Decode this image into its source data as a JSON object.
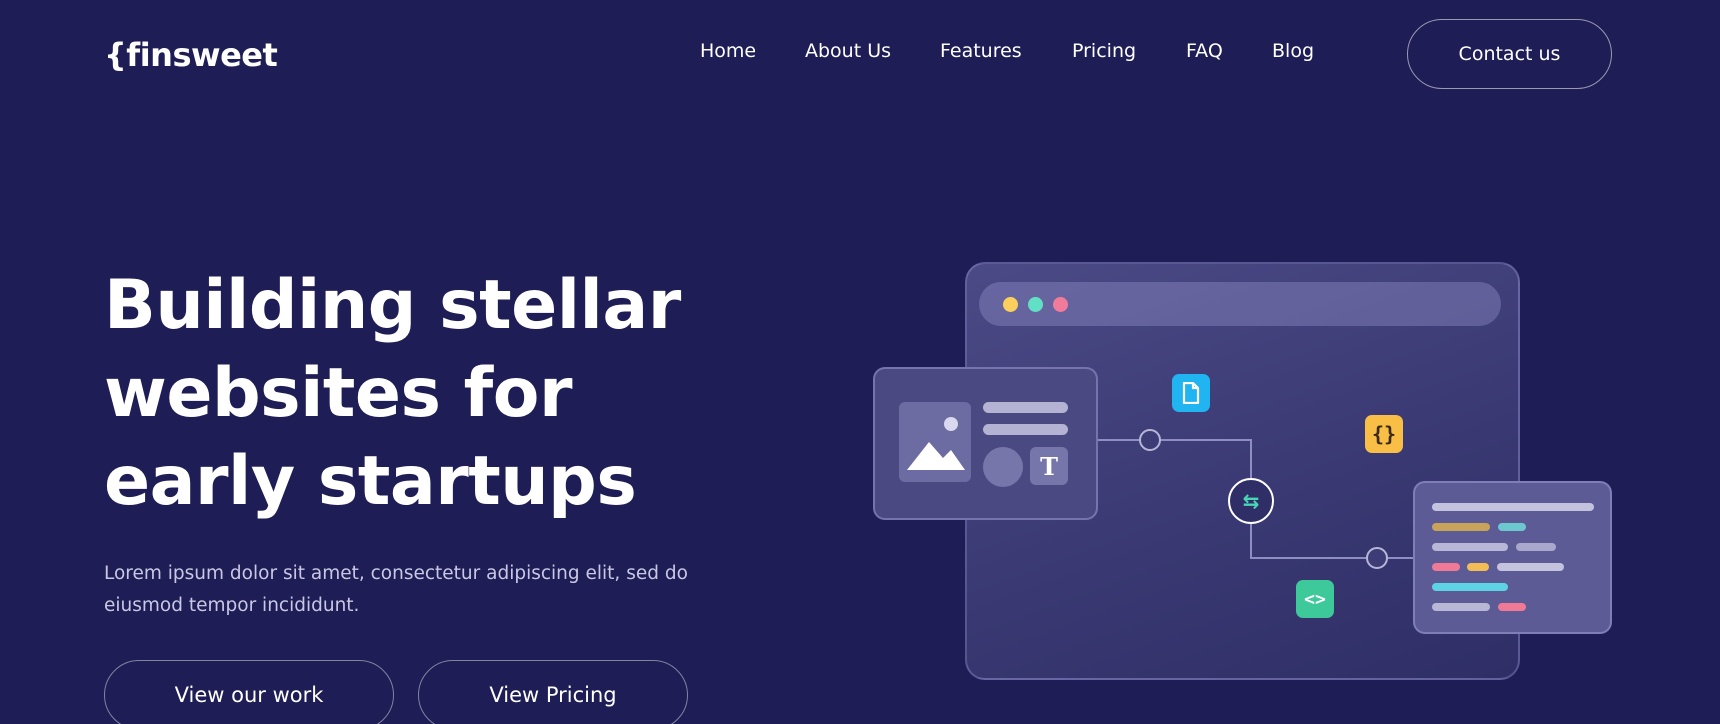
{
  "brand": {
    "logo": "{finsweet"
  },
  "nav": {
    "items": [
      "Home",
      "About Us",
      "Features",
      "Pricing",
      "FAQ",
      "Blog"
    ],
    "contact_label": "Contact us"
  },
  "hero": {
    "title": "Building stellar websites for early startups",
    "subtitle": "Lorem ipsum dolor sit amet, consectetur adipiscing elit, sed do eiusmod tempor incididunt.",
    "primary_cta": "View our work",
    "secondary_cta": "View Pricing"
  },
  "illustration": {
    "json_badge": "{}",
    "code_badge": "<>",
    "text_tile": "T",
    "colors": {
      "background": "#1e1d55",
      "dot_yellow": "#fbcf5b",
      "dot_teal": "#62e0c5",
      "dot_pink": "#f27a9a",
      "file_badge": "#20b4f0",
      "json_badge": "#f8be45",
      "code_badge": "#3ec99a"
    },
    "icons": [
      "image-icon",
      "file-icon",
      "braces-icon",
      "sync-icon",
      "code-icon",
      "text-icon"
    ]
  }
}
